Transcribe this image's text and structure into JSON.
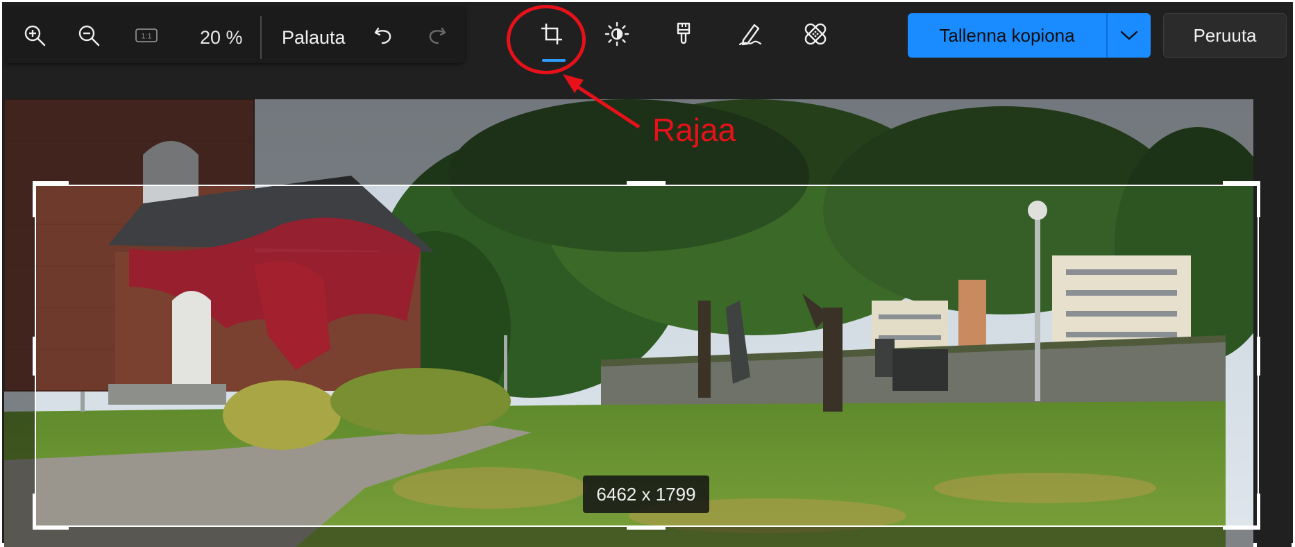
{
  "toolbar": {
    "zoom_in": "zoom-in-icon",
    "zoom_out": "zoom-out-icon",
    "actual_size_label": "1:1",
    "zoom_level": "20 %",
    "reset_label": "Palauta",
    "undo": "undo-icon",
    "redo": "redo-icon"
  },
  "tools": [
    {
      "name": "crop",
      "active": true
    },
    {
      "name": "adjust"
    },
    {
      "name": "filter"
    },
    {
      "name": "markup"
    },
    {
      "name": "retouch"
    }
  ],
  "annotation": {
    "label": "Rajaa",
    "color": "#e8111a"
  },
  "actions": {
    "save_copy_label": "Tallenna kopiona",
    "cancel_label": "Peruuta"
  },
  "crop": {
    "dimensions": "6462 x 1799"
  },
  "colors": {
    "accent": "#1a8cff",
    "indicator": "#2f9bff",
    "background": "#202020"
  }
}
